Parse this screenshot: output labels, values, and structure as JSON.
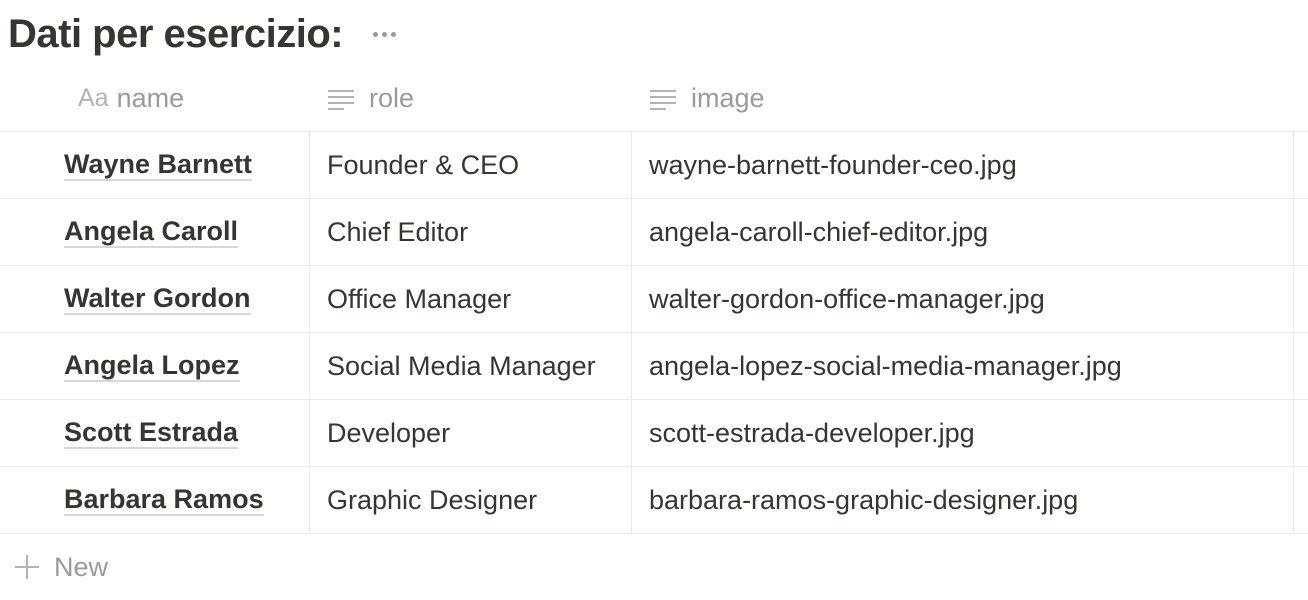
{
  "page": {
    "title": "Dati per esercizio:"
  },
  "table": {
    "columns": [
      {
        "icon": "text-aa-icon",
        "icon_text": "Aa",
        "label": "name"
      },
      {
        "icon": "text-lines-icon",
        "label": "role"
      },
      {
        "icon": "text-lines-icon",
        "label": "image"
      }
    ],
    "rows": [
      {
        "name": "Wayne Barnett",
        "role": "Founder & CEO",
        "image": "wayne-barnett-founder-ceo.jpg"
      },
      {
        "name": "Angela Caroll",
        "role": "Chief Editor",
        "image": "angela-caroll-chief-editor.jpg"
      },
      {
        "name": "Walter Gordon",
        "role": "Office Manager",
        "image": "walter-gordon-office-manager.jpg"
      },
      {
        "name": "Angela Lopez",
        "role": "Social Media Manager",
        "image": "angela-lopez-social-media-manager.jpg"
      },
      {
        "name": "Scott Estrada",
        "role": "Developer",
        "image": "scott-estrada-developer.jpg"
      },
      {
        "name": "Barbara Ramos",
        "role": "Graphic Designer",
        "image": "barbara-ramos-graphic-designer.jpg"
      }
    ],
    "new_label": "New"
  }
}
